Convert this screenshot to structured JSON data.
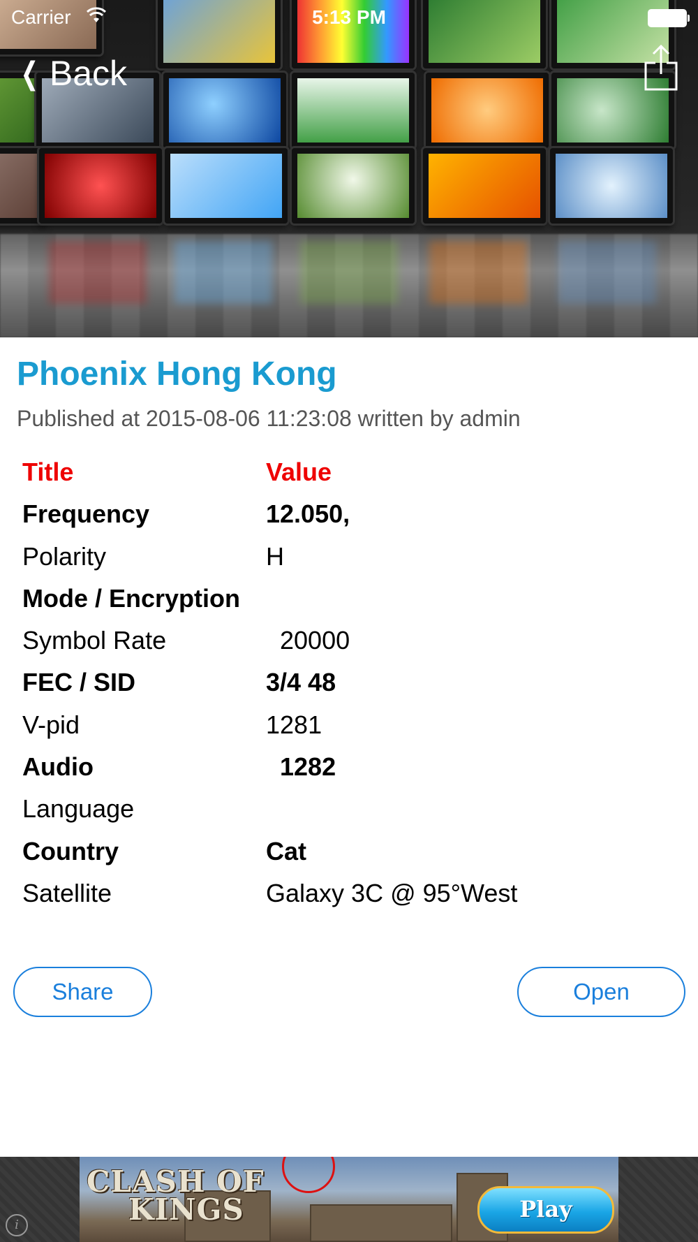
{
  "status_bar": {
    "carrier": "Carrier",
    "time": "5:13 PM"
  },
  "nav": {
    "back_label": "Back",
    "back_icon": "chevron-left-icon",
    "share_icon": "share-icon"
  },
  "article": {
    "title": "Phoenix Hong Kong",
    "meta": "Published at 2015-08-06 11:23:08 written by admin"
  },
  "table": {
    "header": {
      "title": "Title",
      "value": "Value"
    },
    "rows": [
      {
        "label": "Frequency",
        "value": "12.050,"
      },
      {
        "label": "Polarity",
        "value": "H"
      },
      {
        "label": "Mode / Encryption",
        "value": ""
      },
      {
        "label": "Symbol Rate",
        "value": "  20000"
      },
      {
        "label": "FEC / SID",
        "value": "3/4 48"
      },
      {
        "label": "V-pid",
        "value": "1281"
      },
      {
        "label": "Audio",
        "value": "  1282"
      },
      {
        "label": "Language",
        "value": ""
      },
      {
        "label": "Country",
        "value": "Cat"
      },
      {
        "label": "Satellite",
        "value": "Galaxy 3C @ 95°West"
      }
    ]
  },
  "buttons": {
    "share": "Share",
    "open": "Open"
  },
  "ad": {
    "logo_line1": "CLASH OF",
    "logo_line2": "KINGS",
    "play": "Play",
    "info_icon": "info-icon"
  },
  "colors": {
    "title": "#1a9bd0",
    "header": "#ee0000",
    "button": "#1a7fdc"
  }
}
